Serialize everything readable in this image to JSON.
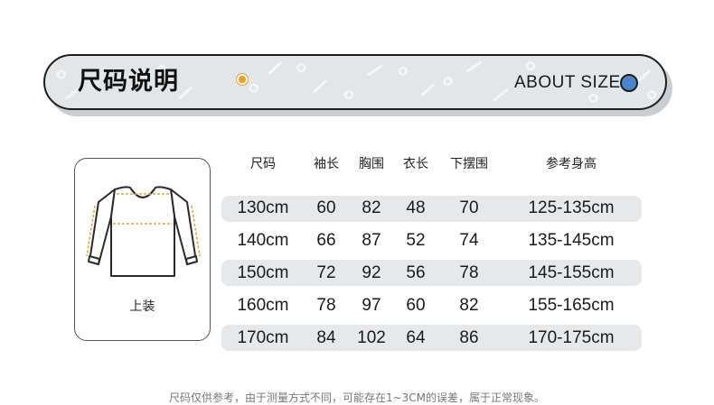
{
  "banner": {
    "title": "尺码说明",
    "subtitle": "ABOUT SIZE",
    "accent_color": "#f39a1f",
    "dot_color": "#4a86c7"
  },
  "garment": {
    "icon": "long-sleeve-shirt-icon",
    "label": "上装",
    "measure_color": "#f0a020"
  },
  "table": {
    "headers": [
      "尺码",
      "袖长",
      "胸围",
      "衣长",
      "下摆围",
      "参考身高"
    ],
    "rows": [
      [
        "130cm",
        "60",
        "82",
        "48",
        "70",
        "125-135cm"
      ],
      [
        "140cm",
        "66",
        "87",
        "52",
        "74",
        "135-145cm"
      ],
      [
        "150cm",
        "72",
        "92",
        "56",
        "78",
        "145-155cm"
      ],
      [
        "160cm",
        "78",
        "97",
        "60",
        "82",
        "155-165cm"
      ],
      [
        "170cm",
        "84",
        "102",
        "64",
        "86",
        "170-175cm"
      ]
    ]
  },
  "footnote": "尺码仅供参考，由于测量方式不同，可能存在1~3CM的误差，属于正常现象。"
}
